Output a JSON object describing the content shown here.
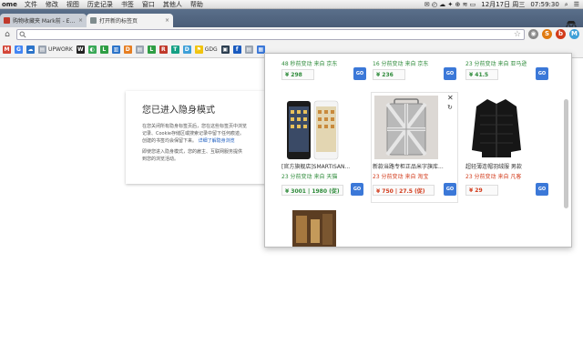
{
  "menubar": {
    "app": "ome",
    "items": [
      "文件",
      "修改",
      "视图",
      "历史记录",
      "书签",
      "窗口",
      "其他人",
      "帮助"
    ],
    "datetime": "12月17日 周三",
    "time": "07:59:30"
  },
  "tabs": [
    {
      "label": "购物收藏夹 Mark前 - Edit扩展",
      "active": false,
      "favicon_color": "#c0392b"
    },
    {
      "label": "打开新的标签页",
      "active": true,
      "favicon_color": "#7f8c8d"
    }
  ],
  "toolbar": {
    "address_value": "",
    "extensions": [
      {
        "name": "extension-gray-icon",
        "color": "#8a8a8a",
        "glyph": "◉"
      },
      {
        "name": "extension-orange-icon",
        "color": "#e07a10",
        "glyph": "S"
      },
      {
        "name": "extension-red-icon",
        "color": "#d23b1b",
        "glyph": "b"
      },
      {
        "name": "extension-mark-icon",
        "color": "#3fa0d8",
        "glyph": "M"
      }
    ]
  },
  "bookmarks": [
    {
      "name": "bookmark-gmail",
      "color": "#d44638",
      "glyph": "M",
      "label": ""
    },
    {
      "name": "bookmark-google",
      "color": "#4285f4",
      "glyph": "G",
      "label": ""
    },
    {
      "name": "bookmark-blue",
      "color": "#2c74c9",
      "glyph": "☁",
      "label": ""
    },
    {
      "name": "bookmark-page",
      "color": "#9aa4b1",
      "glyph": "▤",
      "label": "UPWORK"
    },
    {
      "name": "bookmark-w",
      "color": "#222222",
      "glyph": "W",
      "label": ""
    },
    {
      "name": "bookmark-green1",
      "color": "#3aa857",
      "glyph": "◐",
      "label": ""
    },
    {
      "name": "bookmark-l",
      "color": "#2f9e44",
      "glyph": "L",
      "label": ""
    },
    {
      "name": "bookmark-bar",
      "color": "#2c74c9",
      "glyph": "▥",
      "label": ""
    },
    {
      "name": "bookmark-d",
      "color": "#e67e22",
      "glyph": "D",
      "label": ""
    },
    {
      "name": "bookmark-gray",
      "color": "#9aa4b1",
      "glyph": "▤",
      "label": ""
    },
    {
      "name": "bookmark-l2",
      "color": "#2f9e44",
      "glyph": "L",
      "label": ""
    },
    {
      "name": "bookmark-r",
      "color": "#c0392b",
      "glyph": "R",
      "label": ""
    },
    {
      "name": "bookmark-t",
      "color": "#16a085",
      "glyph": "T",
      "label": ""
    },
    {
      "name": "bookmark-d2",
      "color": "#3fa0d8",
      "glyph": "D",
      "label": ""
    },
    {
      "name": "bookmark-flag",
      "color": "#f1c40f",
      "glyph": "⚑",
      "label": "GDG"
    },
    {
      "name": "bookmark-dark",
      "color": "#2c3e50",
      "glyph": "▣",
      "label": ""
    },
    {
      "name": "bookmark-f",
      "color": "#1a5bbf",
      "glyph": "f",
      "label": ""
    },
    {
      "name": "bookmark-page2",
      "color": "#9aa4b1",
      "glyph": "▤",
      "label": ""
    },
    {
      "name": "bookmark-blue2",
      "color": "#3b78d8",
      "glyph": "▦",
      "label": ""
    }
  ],
  "incognito": {
    "title": "您已进入隐身模式",
    "para1_line1": "在您关闭所有隐身标签页后，您在这些标签页中浏览",
    "para1_line2": "记录、Cookie存储区或搜索记录中留下任何痕迹。",
    "para1_line3": "创建的书签均会保留下来。",
    "para1_link": "详细了解隐身浏览",
    "para2_line1": "即使您进入隐身模式，您的雇主、互联网服务提供",
    "para2_line2": "到您的浏览活动。"
  },
  "popup": {
    "go_label": "GO",
    "items": [
      {
        "meta": "48 秒前变动 来自 京东",
        "price": "¥ 298",
        "price_red": false,
        "title": ""
      },
      {
        "meta": "16 分前变动 来自 京东",
        "price": "¥ 236",
        "price_red": false,
        "title": ""
      },
      {
        "meta": "23 分前变动 来自 亚马逊",
        "price": "¥ 41.5",
        "price_red": false,
        "title": ""
      },
      {
        "meta": "23 分前变动 来自 天猫",
        "price": "¥ 3001 | 1980 (促)",
        "price_red": false,
        "title": "[官方旗舰店]SMARTISAN..."
      },
      {
        "meta": "23 分前变动 来自 淘宝",
        "price": "¥ 750 | 27.5 (促)",
        "price_red": true,
        "title": "新款当路专柜正品米字旗库..."
      },
      {
        "meta": "23 分前变动 来自 凡客",
        "price": "¥ 29",
        "price_red": true,
        "title": "超轻薄连帽羽绒服 男款"
      }
    ]
  }
}
